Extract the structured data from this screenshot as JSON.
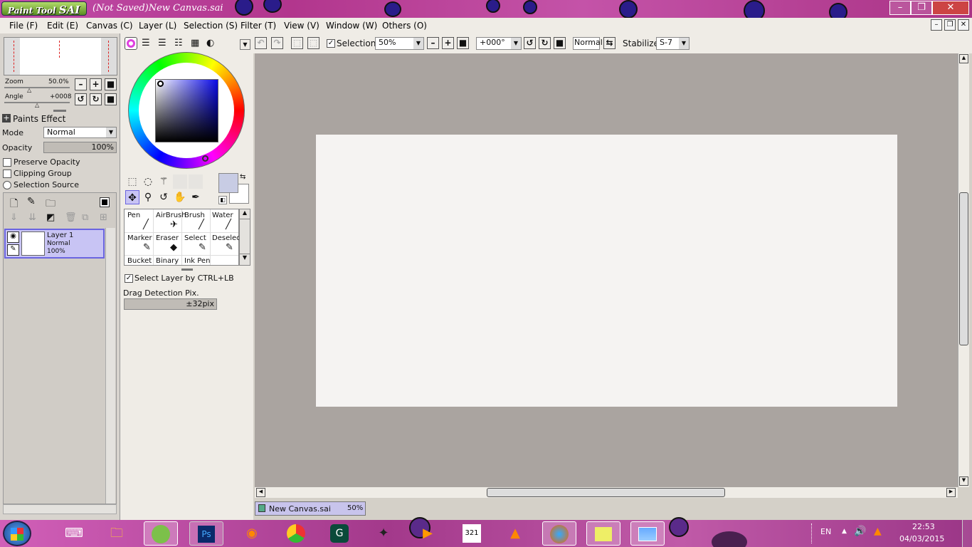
{
  "window": {
    "app_name": "SAI",
    "logo_prefix": "Paint Tool",
    "title": "(Not Saved)New Canvas.sai"
  },
  "menu": [
    "File (F)",
    "Edit (E)",
    "Canvas (C)",
    "Layer (L)",
    "Selection (S)",
    "Filter (T)",
    "View (V)",
    "Window (W)",
    "Others (O)"
  ],
  "navigator": {
    "zoom_label": "Zoom",
    "zoom_value": "50.0%",
    "angle_label": "Angle",
    "angle_value": "+0008"
  },
  "paint_effect": {
    "header": "Paints Effect",
    "mode_label": "Mode",
    "mode_value": "Normal",
    "opacity_label": "Opacity",
    "opacity_value": "100%",
    "preserve_opacity": "Preserve Opacity",
    "clipping_group": "Clipping Group",
    "selection_source": "Selection Source"
  },
  "layer": {
    "name": "Layer 1",
    "mode": "Normal",
    "opacity": "100%"
  },
  "brushes": [
    [
      "Pen",
      "AirBrush",
      "Brush",
      "Water"
    ],
    [
      "Marker",
      "Eraser",
      "Select",
      "Deselect"
    ],
    [
      "Bucket",
      "Binary",
      "Ink Pen",
      ""
    ]
  ],
  "tool_options": {
    "select_layer": "Select Layer by CTRL+LB",
    "drag_detection": "Drag Detection Pix.",
    "drag_value": "±32pix"
  },
  "toolbar": {
    "selection_label": "Selection",
    "zoom_value": "50%",
    "angle_value": "+000°",
    "blend_mode": "Normal",
    "stabilizer_label": "Stabilizer",
    "stabilizer_value": "S-7"
  },
  "doc_tab": {
    "name": "New Canvas.sai",
    "zoom": "50%"
  },
  "taskbar": {
    "lang": "EN",
    "time": "22:53",
    "date": "04/03/2015",
    "apps": [
      "windows-start",
      "keyboard",
      "file-explorer",
      "paint-tool-sai",
      "photoshop",
      "blender",
      "chrome",
      "gamebooster",
      "counter-strike",
      "media-player",
      "calendar-321",
      "vlc",
      "firefox",
      "sticky-notes",
      "photo-viewer"
    ]
  },
  "colors": {
    "accent_layer": "#c8c4f4",
    "canvas_bg": "#aaa4a0",
    "paper": "#f5f3f2",
    "primary_swatch": "#c8cce4"
  }
}
